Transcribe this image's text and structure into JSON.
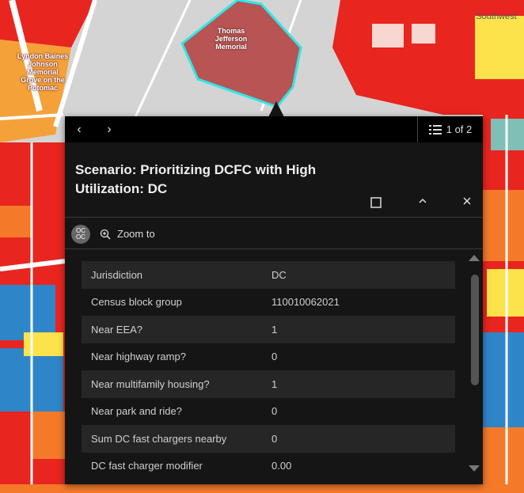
{
  "map": {
    "labels": {
      "memorial": "Thomas\nJefferson\nMemorial",
      "lbj": "Lyndon Baines\nJohnson\nMemorial\nGrove on the\nPotomac",
      "southwest": "Southwest"
    }
  },
  "popup": {
    "pager": "1 of 2",
    "title": "Scenario: Prioritizing DCFC with High Utilization: DC",
    "zoom_label": "Zoom to",
    "avatar_text": "OC\nOC",
    "rows": [
      {
        "field": "Jurisdiction",
        "value": "DC"
      },
      {
        "field": "Census block group",
        "value": "110010062021"
      },
      {
        "field": "Near EEA?",
        "value": "1"
      },
      {
        "field": "Near highway ramp?",
        "value": "0"
      },
      {
        "field": "Near multifamily housing?",
        "value": "1"
      },
      {
        "field": "Near park and ride?",
        "value": "0"
      },
      {
        "field": "Sum DC fast chargers nearby",
        "value": "0"
      },
      {
        "field": "DC fast charger modifier",
        "value": "0.00"
      }
    ]
  },
  "colors": {
    "map_red": "#e8251f",
    "map_orange": "#f47a2a",
    "map_yellow": "#fde34b",
    "map_blue": "#2e86c8",
    "map_gray": "#d4d4d4",
    "highlight": "#2fe6e6",
    "popup_bg": "#151515"
  }
}
